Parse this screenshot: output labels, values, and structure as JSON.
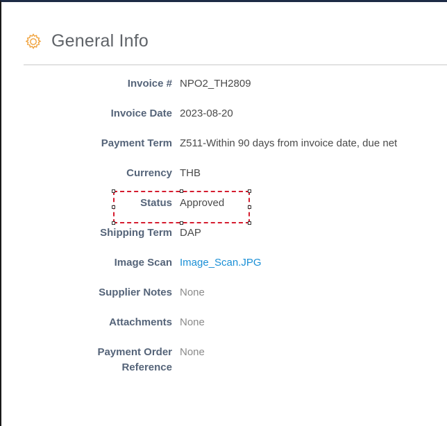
{
  "section": {
    "title": "General Info",
    "icon": "gear-icon"
  },
  "fields": [
    {
      "label": "Invoice #",
      "value": "NPO2_TH2809"
    },
    {
      "label": "Invoice Date",
      "value": "2023-08-20"
    },
    {
      "label": "Payment Term",
      "value": "Z511-Within 90 days from invoice date, due net"
    },
    {
      "label": "Currency",
      "value": "THB"
    },
    {
      "label": "Status",
      "value": "Approved"
    },
    {
      "label": "Shipping Term",
      "value": "DAP"
    },
    {
      "label": "Image Scan",
      "value": "Image_Scan.JPG"
    },
    {
      "label": "Supplier Notes",
      "value": "None"
    },
    {
      "label": "Attachments",
      "value": "None"
    },
    {
      "label": "Payment Order Reference",
      "value": "None"
    }
  ],
  "colors": {
    "label": "#556479",
    "link": "#1a8fd6",
    "gear": "#f0a13a",
    "highlight": "#d51b2e"
  }
}
